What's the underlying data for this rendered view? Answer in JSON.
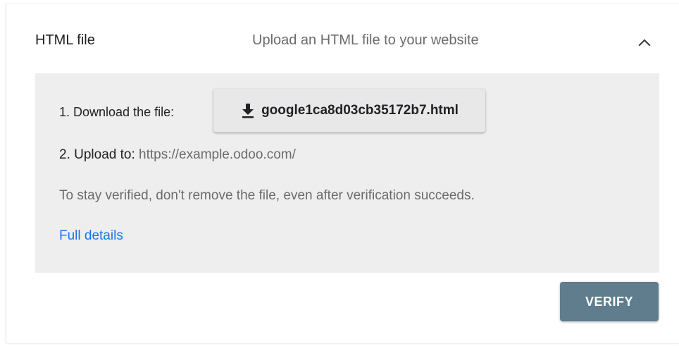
{
  "method": {
    "title": "HTML file",
    "description": "Upload an HTML file to your website",
    "collapse_icon": "chevron-up-icon"
  },
  "steps": {
    "download_label": "1. Download the file:",
    "download_icon": "download-icon",
    "file_name": "google1ca8d03cb35172b7.html",
    "upload_label": "2. Upload to:",
    "upload_url": "https://example.odoo.com/"
  },
  "note": "To stay verified, don't remove the file, even after verification succeeds.",
  "details_link": "Full details",
  "verify_button": "VERIFY",
  "colors": {
    "panel_bg": "#eeeeee",
    "link": "#1a73e8",
    "verify_bg": "#5f7d8c"
  }
}
